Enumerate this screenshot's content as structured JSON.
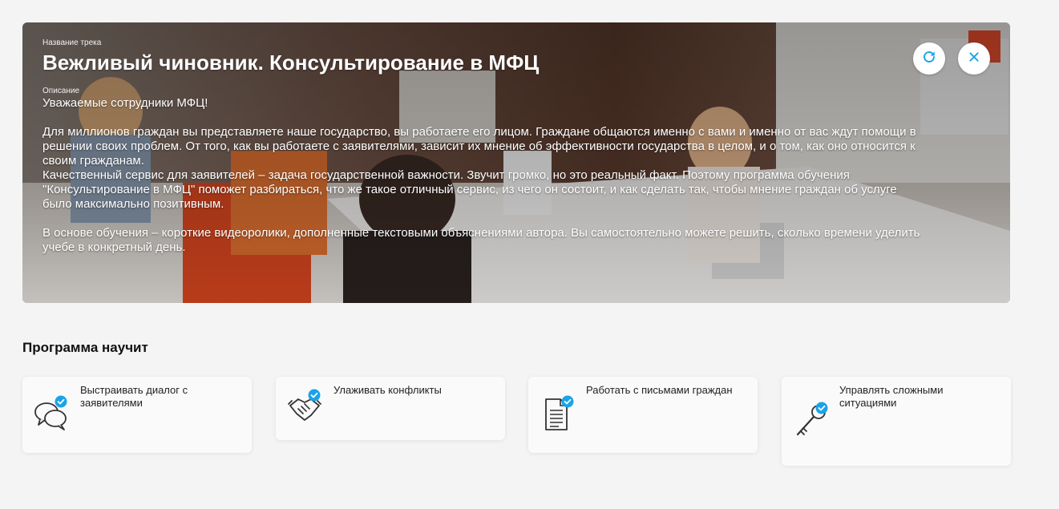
{
  "track": {
    "name_label": "Название трека",
    "title": "Вежливый чиновник. Консультирование в МФЦ",
    "desc_label": "Описание",
    "description": "Уважаемые сотрудники МФЦ!\n\nДля миллионов граждан вы представляете наше государство, вы работаете его лицом. Граждане общаются именно с вами и именно от вас ждут помощи в решении своих проблем. От того, как вы работаете с заявителями, зависит их мнение об эффективности государства в целом, и о том, как оно относится к своим гражданам.\nКачественный сервис для заявителей – задача государственной важности. Звучит громко, но это реальный факт. Поэтому программа обучения \"Консультирование в МФЦ\" поможет разбираться, что же такое отличный сервис, из чего он состоит, и как сделать так, чтобы мнение граждан об услуге было максимально позитивным.\n\nВ основе обучения – короткие видеоролики, дополненные текстовыми объяснениями автора. Вы самостоятельно можете решить, сколько времени уделить учебе в конкретный день."
  },
  "buttons": {
    "refresh_icon": "refresh-icon",
    "close_icon": "close-icon"
  },
  "program": {
    "title": "Программа научит",
    "cards": [
      {
        "label": "Выстраивать диалог с заявителями",
        "icon": "dialog-icon"
      },
      {
        "label": "Улаживать конфликты",
        "icon": "handshake-icon"
      },
      {
        "label": "Работать с письмами граждан",
        "icon": "document-icon"
      },
      {
        "label": "Управлять сложными ситуациями",
        "icon": "key-icon"
      }
    ]
  },
  "colors": {
    "accent": "#1aa3e8",
    "background": "#f4f4f4",
    "card": "#fafafa"
  }
}
